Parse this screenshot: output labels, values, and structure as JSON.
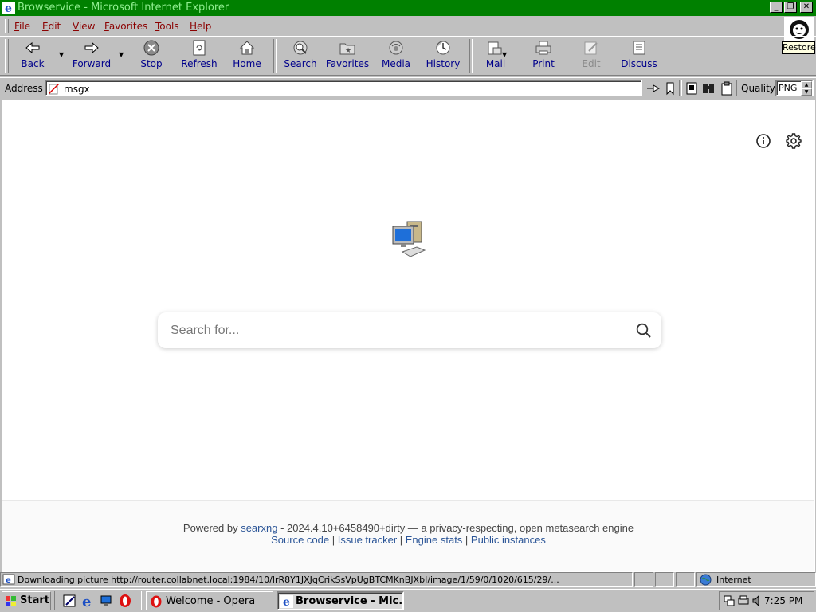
{
  "window": {
    "title": "Browservice - Microsoft Internet Explorer",
    "buttons": {
      "minimize": "_",
      "restore": "❐",
      "close": "✕"
    }
  },
  "menu": {
    "file": {
      "key": "F",
      "rest": "ile"
    },
    "edit": {
      "key": "E",
      "rest": "dit"
    },
    "view": {
      "key": "V",
      "rest": "iew"
    },
    "favorites": {
      "key": "F",
      "rest": "avorites"
    },
    "tools": {
      "key": "T",
      "rest": "ools"
    },
    "help": {
      "key": "H",
      "rest": "elp"
    }
  },
  "restore_tooltip": "Restore",
  "toolbar": {
    "back": "Back",
    "forward": "Forward",
    "stop": "Stop",
    "refresh": "Refresh",
    "home": "Home",
    "search": "Search",
    "favorites": "Favorites",
    "media": "Media",
    "history": "History",
    "mail": "Mail",
    "print": "Print",
    "edit": "Edit",
    "discuss": "Discuss"
  },
  "address": {
    "label": "Address",
    "value": "msgx",
    "quality_label": "Quality",
    "quality_value": "PNG"
  },
  "page": {
    "search_placeholder": "Search for...",
    "footer": {
      "powered_by": "Powered by",
      "searxng_link": "searxng",
      "version_text": " - 2024.4.10+6458490+dirty — a privacy-respecting, open metasearch engine",
      "source_code": "Source code",
      "issue_tracker": "Issue tracker",
      "engine_stats": "Engine stats",
      "public_instances": "Public instances",
      "separator": " | "
    }
  },
  "status": {
    "text": "Downloading picture http://router.collabnet.local:1984/10/IrR8Y1JXJqCrikSsVpUgBTCMKnBJXbI/image/1/59/0/1020/615/29/...",
    "zone": "Internet"
  },
  "taskbar": {
    "start": "Start",
    "tasks": [
      "Welcome - Opera",
      "Browservice - Mic..."
    ],
    "clock": "7:25 PM"
  },
  "colors": {
    "titlebar": "#008000",
    "title_text": "#90ee90",
    "menu_text": "#8b0000",
    "toolbar_text": "#00008b",
    "link": "#2b5597"
  }
}
